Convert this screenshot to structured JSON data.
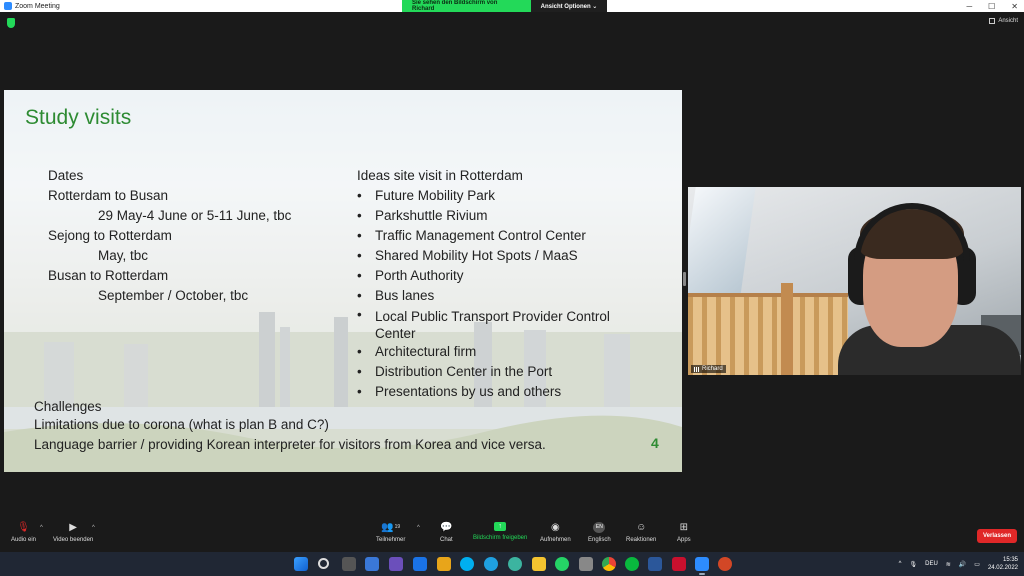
{
  "window": {
    "title": "Zoom Meeting",
    "share_banner": "Sie sehen den Bildschirm von Richard",
    "view_options": "Ansicht Optionen ⌄",
    "controls": [
      "─",
      "☐",
      "✕"
    ]
  },
  "meeting_bar": {
    "view_label": "Ansicht"
  },
  "slide": {
    "title": "Study visits",
    "left_column": [
      {
        "text": "Dates",
        "indent": false
      },
      {
        "text": "Rotterdam to Busan",
        "indent": false
      },
      {
        "text": "29 May-4 June or 5-11 June, tbc",
        "indent": true
      },
      {
        "text": "Sejong to Rotterdam",
        "indent": false
      },
      {
        "text": "May, tbc",
        "indent": true
      },
      {
        "text": "Busan to Rotterdam",
        "indent": false
      },
      {
        "text": "September / October, tbc",
        "indent": true
      }
    ],
    "right_heading": "Ideas  site visit in Rotterdam",
    "right_items": [
      "Future Mobility Park",
      "Parkshuttle Rivium",
      "Traffic Management Control Center",
      "Shared Mobility Hot Spots / MaaS",
      "Porth Authority",
      "Bus lanes",
      "Local Public Transport Provider Control",
      "Center",
      "Architectural firm",
      "Distribution Center in the Port",
      "Presentations by us and others"
    ],
    "challenges_heading": "Challenges",
    "challenges": [
      "Limitations due to corona (what is plan B and C?)",
      "Language barrier / providing Korean interpreter for visitors from Korea and vice versa."
    ],
    "page_number": "4"
  },
  "video": {
    "participant_name": "Richard"
  },
  "toolbar": {
    "audio": {
      "label": "Audio ein",
      "icon": "mic-muted-icon"
    },
    "video": {
      "label": "Video beenden",
      "icon": "video-icon"
    },
    "participants": {
      "label": "Teilnehmer",
      "count": "19",
      "icon": "participants-icon"
    },
    "chat": {
      "label": "Chat",
      "icon": "chat-icon"
    },
    "share": {
      "label": "Bildschirm freigeben",
      "icon": "share-screen-icon"
    },
    "record": {
      "label": "Aufnehmen",
      "icon": "record-icon"
    },
    "language": {
      "label": "Englisch",
      "badge": "EN",
      "icon": "interpretation-icon"
    },
    "reactions": {
      "label": "Reaktionen",
      "icon": "reactions-icon"
    },
    "apps": {
      "label": "Apps",
      "icon": "apps-icon"
    },
    "leave": {
      "label": "Verlassen"
    }
  },
  "taskbar": {
    "language": "DEU",
    "time": "15:35",
    "date": "24.02.2022"
  },
  "colors": {
    "green": "#23d959",
    "slide_title": "#2e8b33",
    "leave": "#e02828",
    "taskbar": "#202734"
  }
}
